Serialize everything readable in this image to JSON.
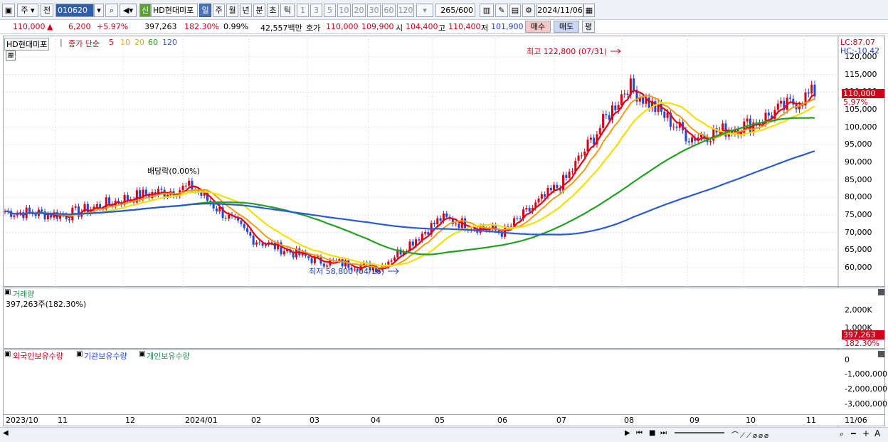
{
  "toolbar": {
    "period": "주",
    "prev": "전",
    "code": "010620",
    "new_badge": "신",
    "name": "HD현대미포",
    "tabs": [
      "일",
      "주",
      "월",
      "년",
      "분",
      "초",
      "틱"
    ],
    "active_tab": "일",
    "intervals": [
      "1",
      "3",
      "5",
      "10",
      "20",
      "30",
      "60",
      "120"
    ],
    "count": "265",
    "count_total": "/600",
    "date": "2024/11/06"
  },
  "quote": {
    "price": "110,000",
    "change": "6,200",
    "pct": "+5.97%",
    "volume": "397,263",
    "vol_ratio": "182.30%",
    "turnover": "0.99%",
    "amount": "42,557백만",
    "hoga_label": "호가",
    "ask": "110,000",
    "bid": "109,900",
    "open_label": "시",
    "open": "104,400",
    "high_label": "고",
    "high": "110,400",
    "low_label": "저",
    "low": "101,900",
    "buy": "매수",
    "sell": "매도",
    "avg": "평"
  },
  "price_panel": {
    "title": "HD현대미포",
    "ma_label": "종가 단순",
    "ma_periods": [
      "5",
      "10",
      "20",
      "60",
      "120"
    ],
    "lc": "LC:87.07",
    "hc": "HC:-10.42",
    "max_note": "최고 122,800 (07/31)",
    "min_note": "최저 58,800 (04/16)",
    "div_note": "배당락(0.00%)",
    "price_tag": "110,000",
    "pct_tag": "5.97%",
    "y_ticks": [
      "120,000",
      "115,000",
      "110,000",
      "105,000",
      "100,000",
      "95,000",
      "90,000",
      "85,000",
      "80,000",
      "75,000",
      "70,000",
      "65,000",
      "60,000"
    ]
  },
  "volume_panel": {
    "title": "거래량",
    "value": "397,263주(182.30%)",
    "y_ticks": [
      "2,000K",
      "1,000K"
    ],
    "tag_value": "397,263",
    "tag_pct": "182.30%"
  },
  "holdings_panel": {
    "series": [
      "외국인보유수량",
      "기관보유수량",
      "개인보유수량"
    ],
    "y_ticks": [
      "0",
      "-1,000,000",
      "-2,000,000",
      "-3,000,000"
    ]
  },
  "x_axis": {
    "labels": [
      "2023/10",
      "11",
      "12",
      "2024/01",
      "02",
      "03",
      "04",
      "05",
      "06",
      "07",
      "08",
      "09",
      "10",
      "11"
    ],
    "right_label": "11/06"
  },
  "colors": {
    "red": "#d0021b",
    "blue": "#2646d8",
    "green": "#2e8b57",
    "ma5": "#e60012",
    "ma10": "#f39c12",
    "ma20": "#f5e000",
    "ma60": "#22a022",
    "ma120": "#2a5bd7"
  },
  "chart_data": {
    "type": "candlestick",
    "approx_monthly_close": {
      "x": [
        "2023/10",
        "11",
        "12",
        "2024/01",
        "02",
        "03",
        "04",
        "05",
        "06",
        "07",
        "08",
        "09",
        "10",
        "11"
      ],
      "close": [
        76000,
        75000,
        80000,
        83000,
        68000,
        62000,
        60000,
        74000,
        70000,
        85000,
        112000,
        97000,
        101000,
        110000
      ]
    },
    "high": 122800,
    "low": 58800,
    "last_close": 110000
  }
}
